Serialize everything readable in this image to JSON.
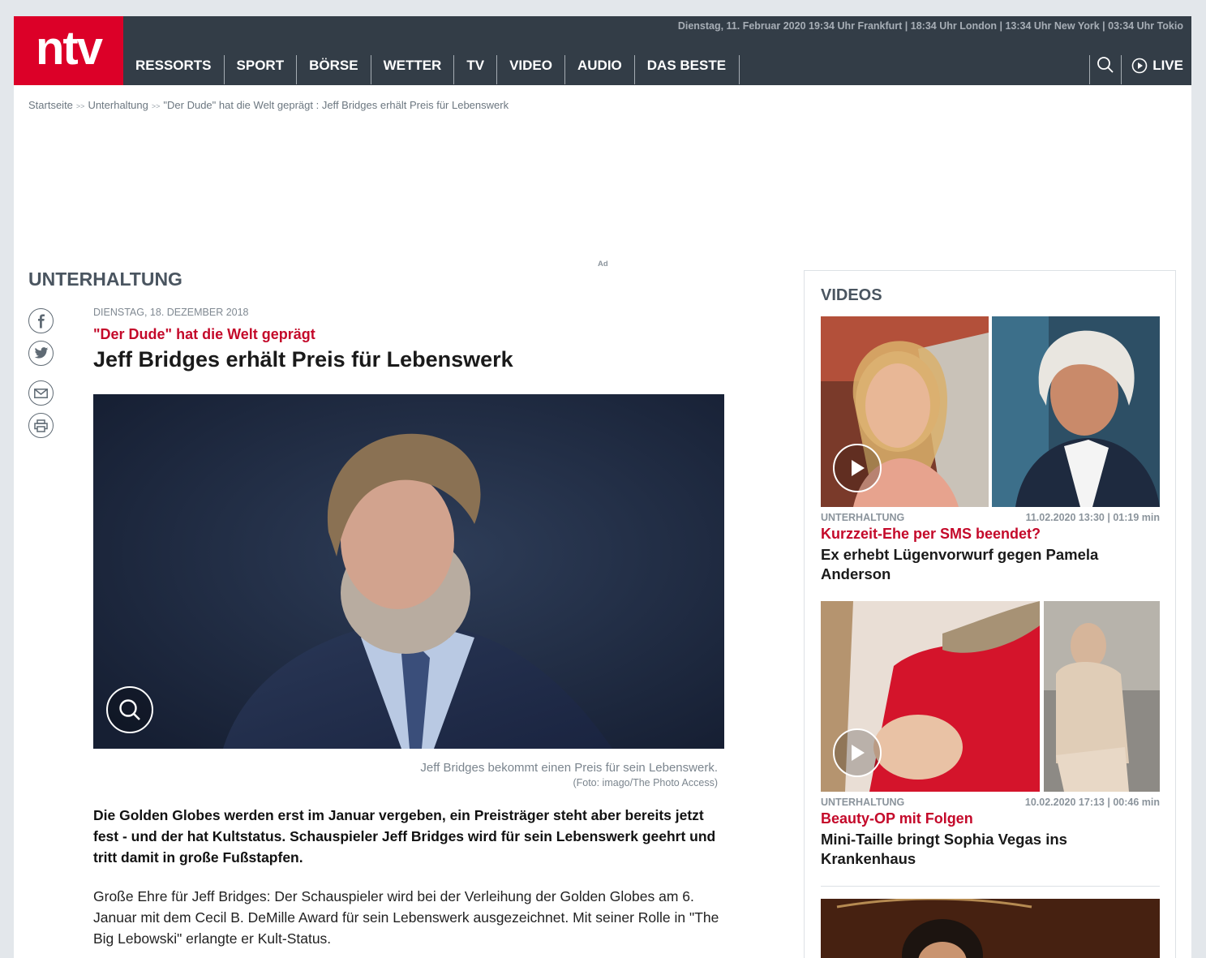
{
  "header": {
    "logo": "ntv",
    "timeline": "Dienstag, 11. Februar 2020  19:34 Uhr Frankfurt | 18:34 Uhr London | 13:34 Uhr New York  | 03:34 Uhr Tokio",
    "nav": [
      "RESSORTS",
      "SPORT",
      "BÖRSE",
      "WETTER",
      "TV",
      "VIDEO",
      "AUDIO",
      "DAS BESTE"
    ],
    "live_label": "LIVE"
  },
  "breadcrumb": {
    "items": [
      "Startseite",
      "Unterhaltung",
      "\"Der Dude\" hat die Welt geprägt : Jeff Bridges erhält Preis für Lebenswerk"
    ],
    "separator": ">>"
  },
  "ad_label": "Ad",
  "section_title": "UNTERHALTUNG",
  "article": {
    "date": "Dienstag, 18. Dezember 2018",
    "kicker": "\"Der Dude\" hat die Welt geprägt",
    "headline": "Jeff Bridges erhält Preis für Lebenswerk",
    "caption": "Jeff Bridges bekommt einen Preis für sein Lebenswerk.",
    "credit": "(Foto: imago/The Photo Access)",
    "lead": "Die Golden Globes werden erst im Januar vergeben, ein Preisträger steht aber bereits jetzt fest - und der hat Kultstatus. Schauspieler Jeff Bridges wird für sein Lebenswerk geehrt und tritt damit in große Fußstapfen.",
    "body": "Große Ehre für Jeff Bridges: Der Schauspieler wird bei der Verleihung der Golden Globes am 6. Januar mit dem Cecil B. DeMille Award für sein Lebenswerk ausgezeichnet. Mit seiner Rolle in \"The Big Lebowski\" erlangte er Kult-Status."
  },
  "social": [
    "facebook-icon",
    "twitter-icon",
    "mail-icon",
    "print-icon"
  ],
  "sidebar": {
    "title": "VIDEOS",
    "videos": [
      {
        "category": "UNTERHALTUNG",
        "meta": "11.02.2020 13:30 | 01:19 min",
        "kicker": "Kurzzeit-Ehe per SMS beendet?",
        "headline": "Ex erhebt Lügenvorwurf gegen Pamela Anderson"
      },
      {
        "category": "UNTERHALTUNG",
        "meta": "10.02.2020 17:13 | 00:46 min",
        "kicker": "Beauty-OP mit Folgen",
        "headline": "Mini-Taille bringt Sophia Vegas ins Krankenhaus"
      }
    ]
  },
  "colors": {
    "brand_red": "#dc0028",
    "header_bg": "#333d47",
    "kicker_red": "#c4092a"
  }
}
